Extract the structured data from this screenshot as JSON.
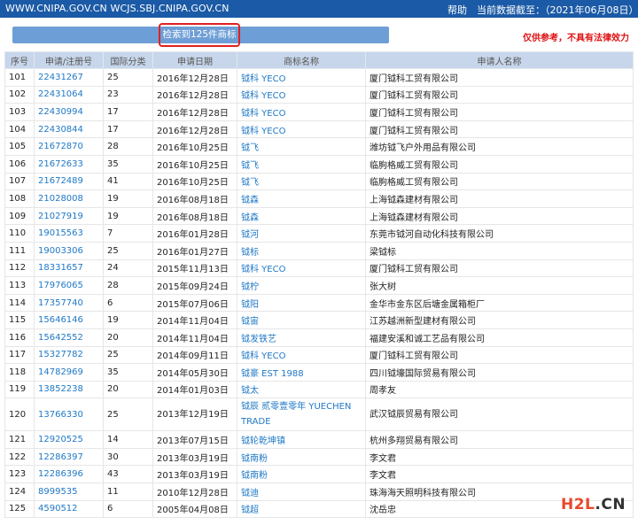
{
  "header": {
    "site": "WWW.CNIPA.GOV.CN WCJS.SBJ.CNIPA.GOV.CN",
    "help": "帮助",
    "date_label": "当前数据截至：（2021年06月08日）"
  },
  "search": {
    "result_label": "检索到125件商标"
  },
  "notice": "仅供参考，不具有法律效力",
  "columns": [
    "序号",
    "申请/注册号",
    "国际分类",
    "申请日期",
    "商标名称",
    "申请人名称"
  ],
  "rows": [
    {
      "no": "101",
      "reg": "22431267",
      "cls": "25",
      "date": "2016年12月28日",
      "name": "钺科 YECO",
      "applicant": "厦门钺科工贸有限公司"
    },
    {
      "no": "102",
      "reg": "22431064",
      "cls": "23",
      "date": "2016年12月28日",
      "name": "钺科 YECO",
      "applicant": "厦门钺科工贸有限公司"
    },
    {
      "no": "103",
      "reg": "22430994",
      "cls": "17",
      "date": "2016年12月28日",
      "name": "钺科 YECO",
      "applicant": "厦门钺科工贸有限公司"
    },
    {
      "no": "104",
      "reg": "22430844",
      "cls": "17",
      "date": "2016年12月28日",
      "name": "钺科 YECO",
      "applicant": "厦门钺科工贸有限公司"
    },
    {
      "no": "105",
      "reg": "21672870",
      "cls": "28",
      "date": "2016年10月25日",
      "name": "钺飞",
      "applicant": "潍坊钺飞户外用品有限公司"
    },
    {
      "no": "106",
      "reg": "21672633",
      "cls": "35",
      "date": "2016年10月25日",
      "name": "钺飞",
      "applicant": "临朐格威工贸有限公司"
    },
    {
      "no": "107",
      "reg": "21672489",
      "cls": "41",
      "date": "2016年10月25日",
      "name": "钺飞",
      "applicant": "临朐格威工贸有限公司"
    },
    {
      "no": "108",
      "reg": "21028008",
      "cls": "19",
      "date": "2016年08月18日",
      "name": "钺森",
      "applicant": "上海钺森建材有限公司"
    },
    {
      "no": "109",
      "reg": "21027919",
      "cls": "19",
      "date": "2016年08月18日",
      "name": "钺森",
      "applicant": "上海钺森建材有限公司"
    },
    {
      "no": "110",
      "reg": "19015563",
      "cls": "7",
      "date": "2016年01月28日",
      "name": "钺河",
      "applicant": "东莞市钺河自动化科技有限公司"
    },
    {
      "no": "111",
      "reg": "19003306",
      "cls": "25",
      "date": "2016年01月27日",
      "name": "钺标",
      "applicant": "梁钺标"
    },
    {
      "no": "112",
      "reg": "18331657",
      "cls": "24",
      "date": "2015年11月13日",
      "name": "钺科 YECO",
      "applicant": "厦门钺科工贸有限公司"
    },
    {
      "no": "113",
      "reg": "17976065",
      "cls": "28",
      "date": "2015年09月24日",
      "name": "钺柠",
      "applicant": "张大树"
    },
    {
      "no": "114",
      "reg": "17357740",
      "cls": "6",
      "date": "2015年07月06日",
      "name": "钺阳",
      "applicant": "金华市金东区后塘金属箱柜厂"
    },
    {
      "no": "115",
      "reg": "15646146",
      "cls": "19",
      "date": "2014年11月04日",
      "name": "钺宙",
      "applicant": "江苏越洲新型建材有限公司"
    },
    {
      "no": "116",
      "reg": "15642552",
      "cls": "20",
      "date": "2014年11月04日",
      "name": "钺发铁艺",
      "applicant": "福建安溪和诚工艺品有限公司"
    },
    {
      "no": "117",
      "reg": "15327782",
      "cls": "25",
      "date": "2014年09月11日",
      "name": "钺科 YECO",
      "applicant": "厦门钺科工贸有限公司"
    },
    {
      "no": "118",
      "reg": "14782969",
      "cls": "35",
      "date": "2014年05月30日",
      "name": "钺豪 EST 1988",
      "applicant": "四川钺壕国际贸易有限公司"
    },
    {
      "no": "119",
      "reg": "13852238",
      "cls": "20",
      "date": "2014年01月03日",
      "name": "钺太",
      "applicant": "周孝友"
    },
    {
      "no": "120",
      "reg": "13766330",
      "cls": "25",
      "date": "2013年12月19日",
      "name": "钺辰 贰零壹零年 YUECHEN TRADE",
      "applicant": "武汉钺辰贸易有限公司",
      "tall": true
    },
    {
      "no": "121",
      "reg": "12920525",
      "cls": "14",
      "date": "2013年07月15日",
      "name": "钺轮乾坤镇",
      "applicant": "杭州多翔贸易有限公司"
    },
    {
      "no": "122",
      "reg": "12286397",
      "cls": "30",
      "date": "2013年03月19日",
      "name": "钺南粉",
      "applicant": "李文君"
    },
    {
      "no": "123",
      "reg": "12286396",
      "cls": "43",
      "date": "2013年03月19日",
      "name": "钺南粉",
      "applicant": "李文君"
    },
    {
      "no": "124",
      "reg": "8999535",
      "cls": "11",
      "date": "2010年12月28日",
      "name": "钺迪",
      "applicant": "珠海海天照明科技有限公司"
    },
    {
      "no": "125",
      "reg": "4590512",
      "cls": "6",
      "date": "2005年04月08日",
      "name": "钺超",
      "applicant": "沈岳忠"
    }
  ],
  "watermark": {
    "h": "H2L",
    "cn": ".CN"
  }
}
